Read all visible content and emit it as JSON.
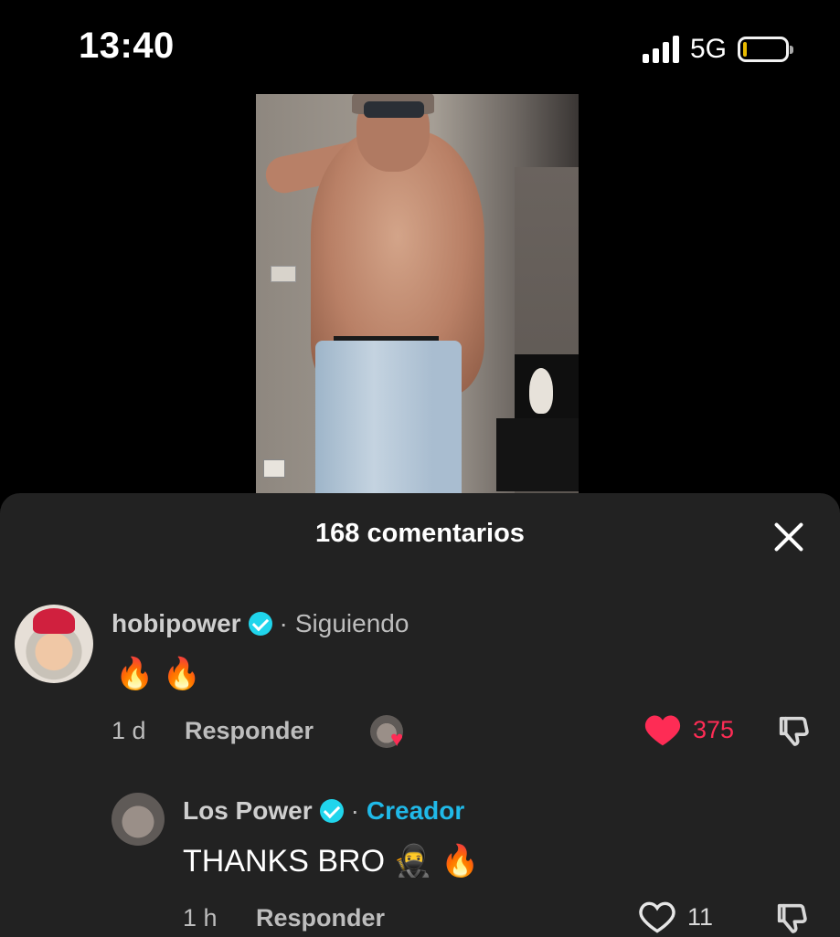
{
  "status_bar": {
    "time": "13:40",
    "network": "5G",
    "battery_level": 0.1,
    "battery_color": "#f5c400"
  },
  "comments_sheet": {
    "title": "168 comentarios",
    "close_icon": "close-icon"
  },
  "comments": [
    {
      "username": "hobipower",
      "verified": true,
      "separator": "·",
      "tag": "Siguiendo",
      "text": "🔥 🔥",
      "time": "1 d",
      "reply_label": "Responder",
      "likes": "375",
      "liked": true,
      "liked_by_creator": true
    }
  ],
  "replies": [
    {
      "username": "Los Power",
      "verified": true,
      "separator": "·",
      "tag": "Creador",
      "text": "THANKS BRO 🥷 🔥",
      "time": "1 h",
      "reply_label": "Responder",
      "likes": "11",
      "liked": false
    }
  ],
  "colors": {
    "like_active": "#fe2c55",
    "verified": "#20d5ec",
    "creator_tag": "#20b9e8",
    "sheet_bg": "#222222"
  }
}
